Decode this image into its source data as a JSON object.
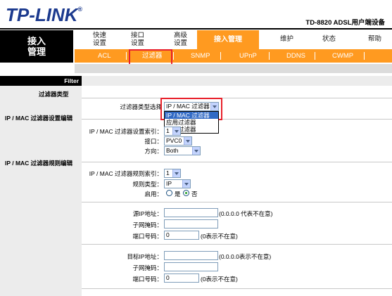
{
  "header": {
    "logo": "TP-LINK",
    "trademark": "®",
    "model": "TD-8820  ADSL用户端设备"
  },
  "sidebar": {
    "title_line1": "接入",
    "title_line2": "管理",
    "filter_label": "Filter",
    "sections": {
      "filter_type": "过滤器类型",
      "ipmac_settings": "IP / MAC 过滤器设置编辑",
      "ipmac_rules": "IP / MAC 过滤器规则编辑"
    }
  },
  "nav": {
    "items": [
      {
        "label1": "快速",
        "label2": "设置"
      },
      {
        "label1": "接口",
        "label2": "设置"
      },
      {
        "label1": "高级",
        "label2": "设置"
      }
    ],
    "active": "接入管理",
    "right_items": [
      "维护",
      "状态",
      "帮助"
    ]
  },
  "subnav": {
    "items": [
      "ACL",
      "过滤器",
      "SNMP",
      "UPnP",
      "DDNS",
      "CWMP"
    ],
    "active_index": 1
  },
  "form": {
    "filter_type_label": "过滤器类型选择",
    "filter_type_value": "IP / MAC 过滤器",
    "filter_type_options": [
      "IP / MAC 过滤器",
      "应用过滤器",
      "URL过滤器"
    ],
    "settings_index_label": "IP / MAC 过滤器设置索引：",
    "settings_index_value": "1",
    "interface_label": "接口：",
    "interface_value": "PVC0",
    "direction_label": "方向：",
    "direction_value": "Both",
    "rule_index_label": "IP / MAC 过滤器规则索引：",
    "rule_index_value": "1",
    "rule_type_label": "规则类型：",
    "rule_type_value": "IP",
    "enable_label": "启用：",
    "enable_yes": "是",
    "enable_no": "否",
    "enable_value": "否",
    "src_ip_label": "源IP地址：",
    "src_ip_value": "",
    "src_ip_hint": "(0.0.0.0 代表不在意)",
    "src_mask_label": "子网掩码：",
    "src_mask_value": "",
    "src_port_label": "端口号码：",
    "src_port_value": "0",
    "src_port_hint": "(0表示不在意)",
    "dst_ip_label": "目标IP地址：",
    "dst_ip_value": "",
    "dst_ip_hint": "(0.0.0.0表示不在意)",
    "dst_mask_label": "子网掩码：",
    "dst_mask_value": "",
    "dst_port_label": "端口号码：",
    "dst_port_value": "0",
    "dst_port_hint": "(0表示不在意)"
  },
  "colors": {
    "brand": "#1c3a8e",
    "accent": "#ff9a20",
    "highlight": "#e8212b",
    "selection": "#316ac5"
  }
}
